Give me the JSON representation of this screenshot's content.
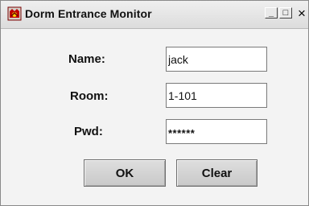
{
  "window": {
    "title": "Dorm Entrance Monitor",
    "controls": {
      "minimize": "_",
      "maximize": "□",
      "close": "×"
    }
  },
  "form": {
    "name_label": "Name:",
    "name_value": "jack",
    "room_label": "Room:",
    "room_value": "1-101",
    "pwd_label": "Pwd:",
    "pwd_value": "******"
  },
  "buttons": {
    "ok": "OK",
    "clear": "Clear"
  },
  "icon": "app-icon"
}
